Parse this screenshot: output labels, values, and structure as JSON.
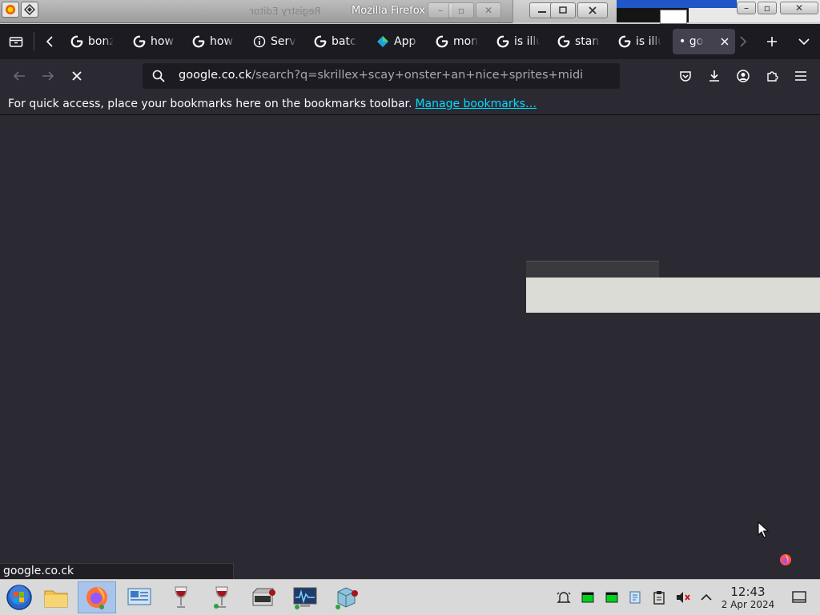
{
  "window": {
    "title": "Mozilla Firefox",
    "ghost_title": "Registry Editor"
  },
  "tabs": [
    {
      "label": "bonz",
      "icon": "google-icon"
    },
    {
      "label": "how",
      "icon": "google-icon"
    },
    {
      "label": "how",
      "icon": "google-icon"
    },
    {
      "label": "Serv",
      "icon": "info-icon"
    },
    {
      "label": "batc",
      "icon": "google-icon"
    },
    {
      "label": "App",
      "icon": "app-icon"
    },
    {
      "label": "mon",
      "icon": "google-icon"
    },
    {
      "label": "is illu",
      "icon": "google-icon"
    },
    {
      "label": "stan",
      "icon": "google-icon"
    },
    {
      "label": "is illu",
      "icon": "google-icon"
    },
    {
      "label": "• go",
      "icon": "loading",
      "active": true
    }
  ],
  "urlbar": {
    "domain": "google.co.ck",
    "path": "/search?q=skrillex+scay+onster+an+nice+sprites+midi"
  },
  "bookmarks": {
    "hint": "For quick access, place your bookmarks here on the bookmarks toolbar.",
    "manage_link": "Manage bookmarks…"
  },
  "status": {
    "text": "google.co.ck"
  },
  "taskbar": {
    "apps": [
      "start-button",
      "file-manager",
      "firefox",
      "network-settings",
      "wine-1",
      "wine-2",
      "wine-app",
      "system-monitor",
      "package-app"
    ],
    "clock_time": "12:43",
    "clock_date": "2 Apr 2024"
  },
  "colors": {
    "page_bg": "#2b2a33",
    "tabstrip_bg": "#1c1b22",
    "link": "#00ddff",
    "taskbar_bg": "#d9d9d9"
  }
}
